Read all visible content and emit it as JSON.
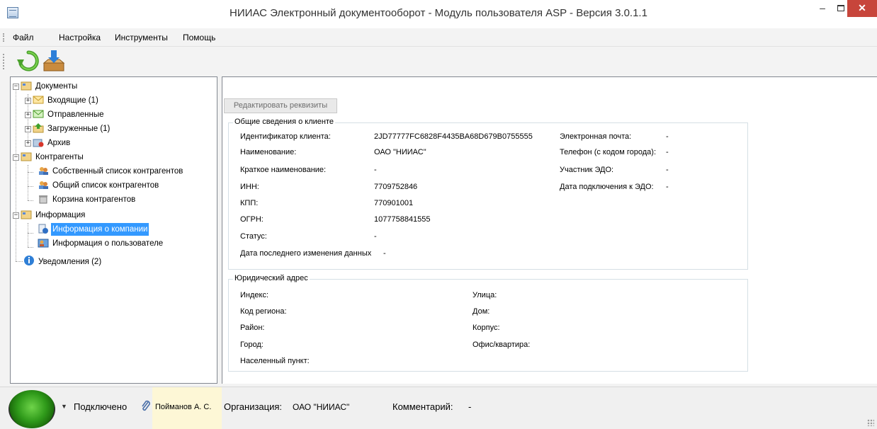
{
  "window": {
    "title": "НИИАС Электронный документооборот - Модуль пользователя ASP - Версия 3.0.1.1",
    "min_symbol": "–",
    "close_symbol": "✕"
  },
  "menu": {
    "items": [
      "Файл",
      "Настройка",
      "Инструменты",
      "Помощь"
    ]
  },
  "toolbar": {
    "buttons": [
      {
        "icon": "refresh-icon"
      },
      {
        "icon": "download-inbox-icon"
      }
    ]
  },
  "tree": {
    "documents": "Документы",
    "incoming": "Входящие (1)",
    "sent": "Отправленные",
    "uploaded": "Загруженные (1)",
    "archive": "Архив",
    "contractors": "Контрагенты",
    "own_list": "Собственный список контрагентов",
    "common_list": "Общий список контрагентов",
    "bin": "Корзина контрагентов",
    "information": "Информация",
    "company_info": "Информация о компании",
    "user_info": "Информация о пользователе",
    "notifications": "Уведомления (2)"
  },
  "content": {
    "edit_button": "Редактировать реквизиты",
    "general": {
      "title": "Общие сведения о клиенте",
      "client_id_label": "Идентификатор клиента:",
      "client_id_value": "2JD77777FC6828F4435BA68D679B0755555",
      "name_label": "Наименование:",
      "name_value": "ОАО \"НИИАС\"",
      "short_name_label": "Краткое наименование:",
      "short_name_value": "-",
      "inn_label": "ИНН:",
      "inn_value": "7709752846",
      "kpp_label": "КПП:",
      "kpp_value": "770901001",
      "ogrn_label": "ОГРН:",
      "ogrn_value": "1077758841555",
      "status_label": "Статус:",
      "status_value": "-",
      "last_change_label": "Дата последнего изменения данных",
      "last_change_value": "-",
      "email_label": "Электронная почта:",
      "email_value": "-",
      "phone_label": "Телефон (с кодом города):",
      "phone_value": "-",
      "edo_member_label": "Участник ЭДО:",
      "edo_member_value": "-",
      "edo_date_label": "Дата подключения к ЭДО:",
      "edo_date_value": "-"
    },
    "address": {
      "title": "Юридический адрес",
      "index_label": "Индекс:",
      "region_label": "Код региона:",
      "district_label": "Район:",
      "city_label": "Город:",
      "settlement_label": "Населенный пункт:",
      "street_label": "Улица:",
      "house_label": "Дом:",
      "building_label": "Корпус:",
      "office_label": "Офис/квартира:"
    }
  },
  "status": {
    "connection": "Подключено",
    "user": "Пойманов А. С.",
    "org_label": "Организация:",
    "org_value": "ОАО \"НИИАС\"",
    "comment_label": "Комментарий:",
    "comment_value": "-"
  }
}
